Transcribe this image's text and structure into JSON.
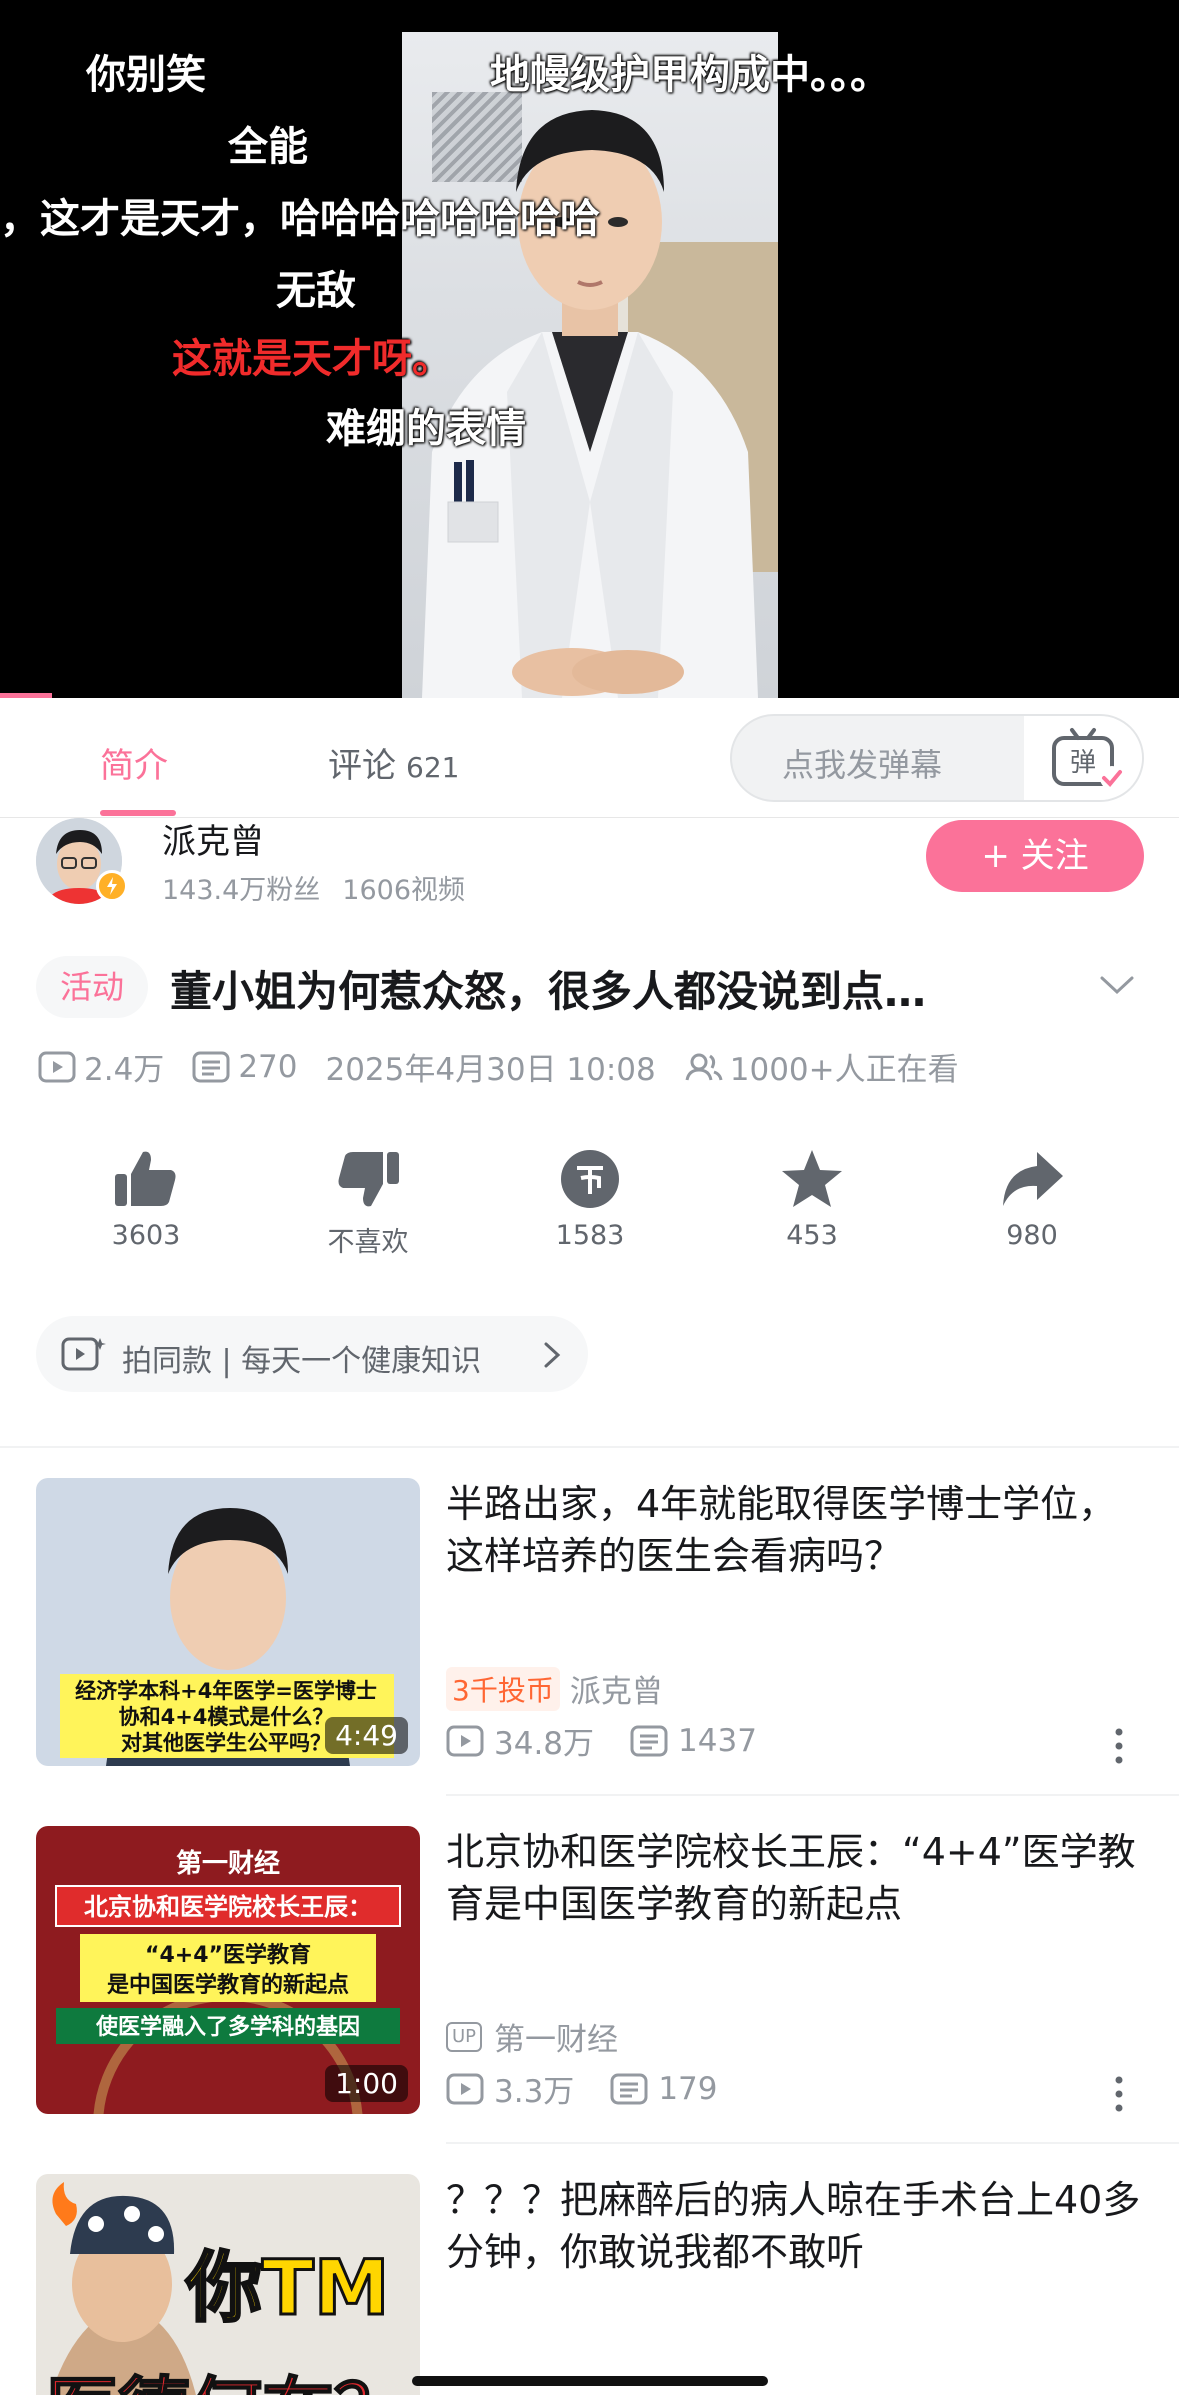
{
  "video": {
    "danmaku": [
      {
        "text": "你别笑",
        "color": "white"
      },
      {
        "text": "地幔级护甲构成中。。。",
        "color": "white"
      },
      {
        "text": "全能",
        "color": "white"
      },
      {
        "text": "，这才是天才，哈哈哈哈哈哈哈哈",
        "color": "white"
      },
      {
        "text": "无敌",
        "color": "white"
      },
      {
        "text": "这就是天才呀。",
        "color": "red"
      },
      {
        "text": "难绷的表情",
        "color": "white"
      }
    ]
  },
  "tabs": {
    "intro": "简介",
    "comments": "评论",
    "comments_count": "621",
    "danmaku_placeholder": "点我发弹幕",
    "danmaku_button": "弹"
  },
  "uploader": {
    "name": "派克曾",
    "fans": "143.4万粉丝",
    "videos": "1606视频",
    "follow_label": "+ 关注"
  },
  "video_info": {
    "tag": "活动",
    "title": "董小姐为何惹众怒，很多人都没说到点…",
    "views": "2.4万",
    "danmaku_count": "270",
    "publish_time": "2025年4月30日 10:08",
    "watching": "1000+人正在看"
  },
  "actions": {
    "like": "3603",
    "dislike": "不喜欢",
    "coin": "1583",
    "favorite": "453",
    "share": "980"
  },
  "same_style": {
    "text": "拍同款 | 每天一个健康知识"
  },
  "related": [
    {
      "title": "半路出家，4年就能取得医学博士学位，这样培养的医生会看病吗？",
      "badge": "3千投币",
      "up": "派克曾",
      "views": "34.8万",
      "danmaku": "1437",
      "duration": "4:49",
      "thumb_caption": [
        "经济学本科+4年医学=医学博士",
        "协和4+4模式是什么？",
        "对其他医学生公平吗？"
      ]
    },
    {
      "title": "北京协和医学院校长王辰：“4+4”医学教育是中国医学教育的新起点",
      "up_badge": "UP",
      "up": "第一财经",
      "views": "3.3万",
      "danmaku": "179",
      "duration": "1:00",
      "thumb_caption": [
        "第一财经",
        "北京协和医学院校长王辰：",
        "“4+4”医学教育",
        "是中国医学教育的新起点",
        "使医学融入了多学科的基因"
      ]
    },
    {
      "title": "？？？把麻醉后的病人晾在手术台上40多分钟，你敢说我都不敢听",
      "thumb_caption": [
        "你TM",
        "医德何在？"
      ]
    }
  ]
}
